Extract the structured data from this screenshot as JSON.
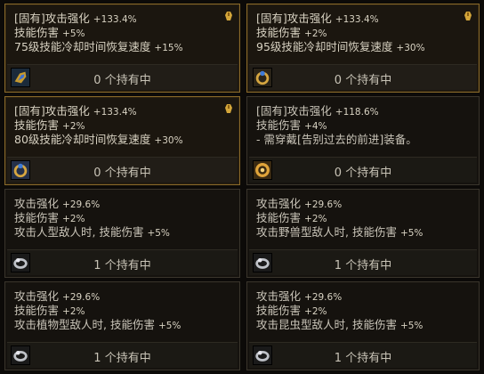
{
  "colors": {
    "gold_border": "#8a6a2a",
    "text": "#d8d2c2",
    "panel_bg": "#15120e"
  },
  "cards": [
    {
      "lines": [
        {
          "label": "[固有]攻击强化",
          "value": "+133.4%"
        },
        {
          "label": "技能伤害",
          "value": "+5%"
        },
        {
          "label": "75级技能冷却时间恢复速度",
          "value": "+15%"
        }
      ],
      "count": "0 个持有中",
      "icon": "gold-gauntlet-icon"
    },
    {
      "lines": [
        {
          "label": "[固有]攻击强化",
          "value": "+133.4%"
        },
        {
          "label": "技能伤害",
          "value": "+2%"
        },
        {
          "label": "95级技能冷却时间恢复速度",
          "value": "+30%"
        }
      ],
      "count": "0 个持有中",
      "icon": "gold-ring-icon"
    },
    {
      "lines": [
        {
          "label": "[固有]攻击强化",
          "value": "+133.4%"
        },
        {
          "label": "技能伤害",
          "value": "+2%"
        },
        {
          "label": "80级技能冷却时间恢复速度",
          "value": "+30%"
        }
      ],
      "count": "0 个持有中",
      "icon": "gold-ring-icon"
    },
    {
      "lines": [
        {
          "label": "[固有]攻击强化",
          "value": "+118.6%"
        },
        {
          "label": "技能伤害",
          "value": "+4%"
        },
        {
          "label": "- 需穿戴[告别过去的前进]装备。",
          "value": ""
        }
      ],
      "count": "0 个持有中",
      "icon": "gold-ring-icon"
    },
    {
      "lines": [
        {
          "label": "攻击强化",
          "value": "+29.6%"
        },
        {
          "label": "技能伤害",
          "value": "+2%"
        },
        {
          "label": "攻击人型敌人时, 技能伤害",
          "value": "+5%"
        }
      ],
      "count": "1 个持有中",
      "icon": "silver-ring-icon"
    },
    {
      "lines": [
        {
          "label": "攻击强化",
          "value": "+29.6%"
        },
        {
          "label": "技能伤害",
          "value": "+2%"
        },
        {
          "label": "攻击野兽型敌人时, 技能伤害",
          "value": "+5%"
        }
      ],
      "count": "1 个持有中",
      "icon": "silver-ring-icon"
    },
    {
      "lines": [
        {
          "label": "攻击强化",
          "value": "+29.6%"
        },
        {
          "label": "技能伤害",
          "value": "+2%"
        },
        {
          "label": "攻击植物型敌人时, 技能伤害",
          "value": "+5%"
        }
      ],
      "count": "1 个持有中",
      "icon": "silver-ring-icon"
    },
    {
      "lines": [
        {
          "label": "攻击强化",
          "value": "+29.6%"
        },
        {
          "label": "技能伤害",
          "value": "+2%"
        },
        {
          "label": "攻击昆虫型敌人时, 技能伤害",
          "value": "+5%"
        }
      ],
      "count": "1 个持有中",
      "icon": "silver-ring-icon"
    }
  ]
}
